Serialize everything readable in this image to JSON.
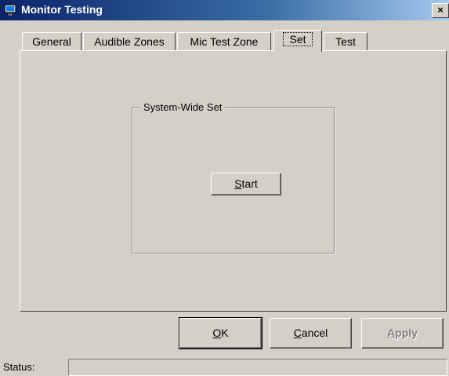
{
  "window": {
    "title": "Monitor Testing",
    "close_glyph": "×",
    "icon": "monitor-icon"
  },
  "tabs": [
    {
      "label": "General"
    },
    {
      "label": "Audible Zones"
    },
    {
      "label": "Mic Test Zone"
    },
    {
      "label": "Set",
      "active": true
    },
    {
      "label": "Test"
    }
  ],
  "group": {
    "title": "System-Wide Set",
    "start_mnemonic": "S",
    "start_rest": "tart"
  },
  "buttons": {
    "ok_mnemonic": "O",
    "ok_rest": "K",
    "cancel_mnemonic": "C",
    "cancel_rest": "ancel",
    "apply_mnemonic": "A",
    "apply_rest": "pply"
  },
  "status": {
    "label": "Status:",
    "value": ""
  },
  "colors": {
    "face": "#d4d0c8",
    "titlebar_start": "#0a246a",
    "titlebar_end": "#a6caf0"
  }
}
